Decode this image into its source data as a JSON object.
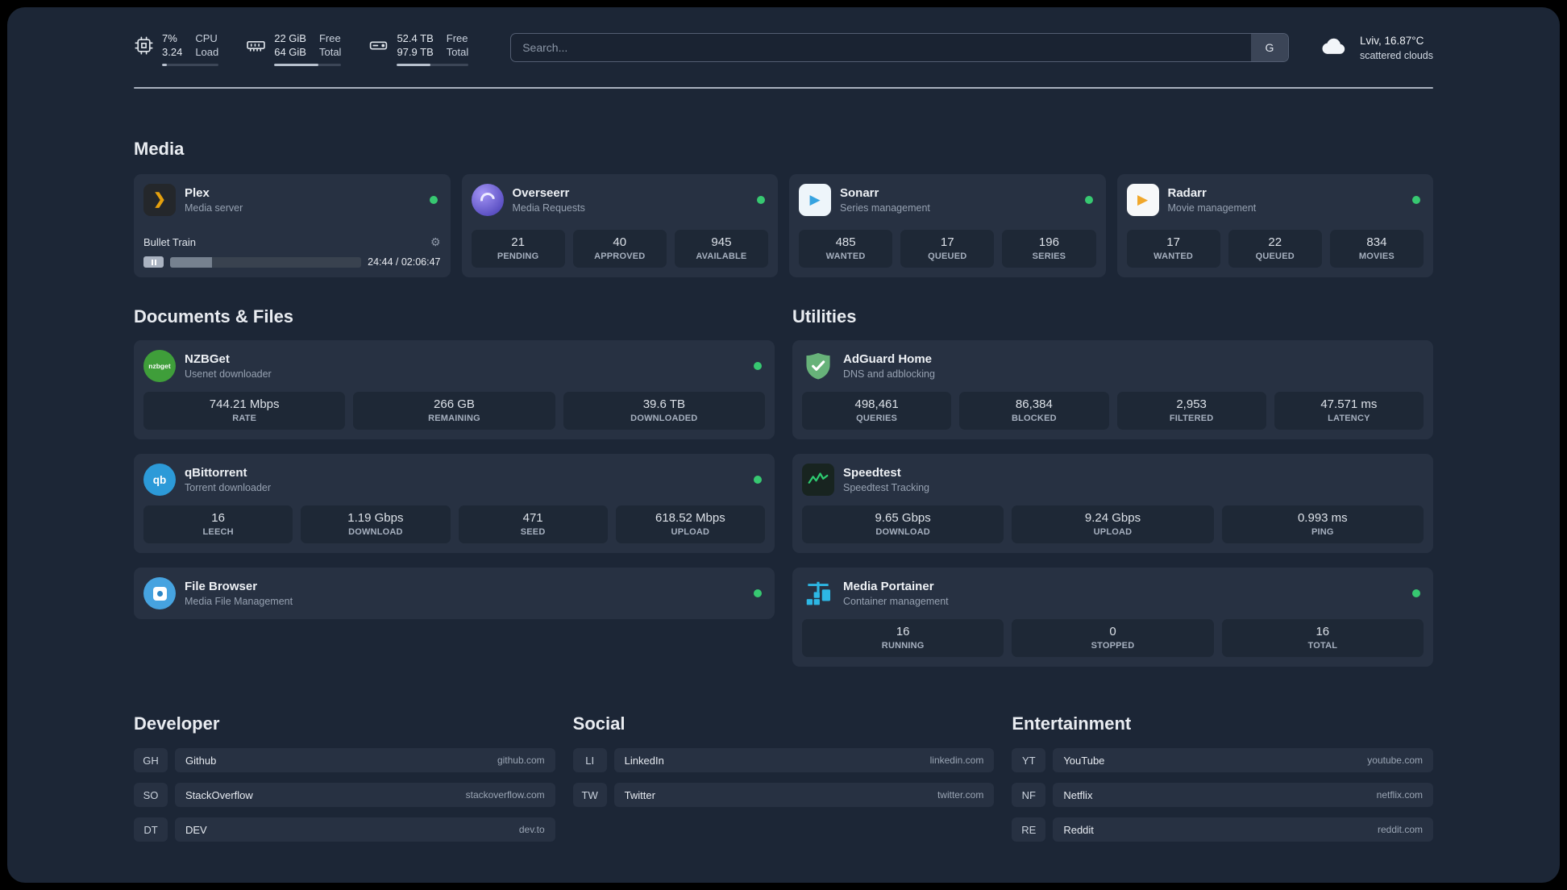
{
  "colors": {
    "status_online": "#37c871",
    "accent_plex": "#e5a00d",
    "accent_overseerr": "#7b6cf0",
    "accent_sonarr": "#36a3e0",
    "accent_radarr": "#f0a72b",
    "accent_nzbget": "#3f9e3a",
    "accent_qbittorrent": "#2c9ad8",
    "accent_adguard": "#67b279",
    "accent_speedtest": "#2ecc71",
    "accent_filebrowser": "#46a3e0",
    "accent_portainer": "#2db7e4"
  },
  "topbar": {
    "cpu": {
      "icon": "cpu-chip-icon",
      "percent": "7%",
      "load": "3.24",
      "label_top": "CPU",
      "label_bottom": "Load",
      "bar_percent": 8
    },
    "memory": {
      "icon": "ram-icon",
      "free": "22 GiB",
      "total": "64 GiB",
      "label_top": "Free",
      "label_bottom": "Total",
      "bar_percent": 66
    },
    "disk": {
      "icon": "hard-drive-icon",
      "free": "52.4 TB",
      "total": "97.9 TB",
      "label_top": "Free",
      "label_bottom": "Total",
      "bar_percent": 47
    },
    "search": {
      "placeholder": "Search...",
      "button": "G"
    },
    "weather": {
      "icon": "cloud-icon",
      "location": "Lviv, 16.87°C",
      "condition": "scattered clouds"
    }
  },
  "sections": {
    "media": {
      "title": "Media",
      "plex": {
        "name": "Plex",
        "subtitle": "Media server",
        "icon": "plex-icon",
        "online": true,
        "now_playing": {
          "title": "Bullet Train",
          "time": "24:44 / 02:06:47",
          "progress_percent": 22
        }
      },
      "overseerr": {
        "name": "Overseerr",
        "subtitle": "Media Requests",
        "icon": "overseerr-icon",
        "online": true,
        "stats": [
          {
            "value": "21",
            "label": "PENDING"
          },
          {
            "value": "40",
            "label": "APPROVED"
          },
          {
            "value": "945",
            "label": "AVAILABLE"
          }
        ]
      },
      "sonarr": {
        "name": "Sonarr",
        "subtitle": "Series management",
        "icon": "sonarr-icon",
        "online": true,
        "stats": [
          {
            "value": "485",
            "label": "WANTED"
          },
          {
            "value": "17",
            "label": "QUEUED"
          },
          {
            "value": "196",
            "label": "SERIES"
          }
        ]
      },
      "radarr": {
        "name": "Radarr",
        "subtitle": "Movie management",
        "icon": "radarr-icon",
        "online": true,
        "stats": [
          {
            "value": "17",
            "label": "WANTED"
          },
          {
            "value": "22",
            "label": "QUEUED"
          },
          {
            "value": "834",
            "label": "MOVIES"
          }
        ]
      }
    },
    "documents": {
      "title": "Documents & Files",
      "nzbget": {
        "name": "NZBGet",
        "subtitle": "Usenet downloader",
        "icon": "nzbget-icon",
        "icon_word": "nzbget",
        "online": true,
        "stats": [
          {
            "value": "744.21 Mbps",
            "label": "RATE"
          },
          {
            "value": "266 GB",
            "label": "REMAINING"
          },
          {
            "value": "39.6 TB",
            "label": "DOWNLOADED"
          }
        ]
      },
      "qbittorrent": {
        "name": "qBittorrent",
        "subtitle": "Torrent downloader",
        "icon": "qbittorrent-icon",
        "icon_word": "qb",
        "online": true,
        "stats": [
          {
            "value": "16",
            "label": "LEECH"
          },
          {
            "value": "1.19 Gbps",
            "label": "DOWNLOAD"
          },
          {
            "value": "471",
            "label": "SEED"
          },
          {
            "value": "618.52 Mbps",
            "label": "UPLOAD"
          }
        ]
      },
      "filebrowser": {
        "name": "File Browser",
        "subtitle": "Media File Management",
        "icon": "filebrowser-icon",
        "online": true
      }
    },
    "utilities": {
      "title": "Utilities",
      "adguard": {
        "name": "AdGuard Home",
        "subtitle": "DNS and adblocking",
        "icon": "adguard-shield-icon",
        "stats": [
          {
            "value": "498,461",
            "label": "QUERIES"
          },
          {
            "value": "86,384",
            "label": "BLOCKED"
          },
          {
            "value": "2,953",
            "label": "FILTERED"
          },
          {
            "value": "47.571 ms",
            "label": "LATENCY"
          }
        ]
      },
      "speedtest": {
        "name": "Speedtest",
        "subtitle": "Speedtest Tracking",
        "icon": "speedtest-graph-icon",
        "stats": [
          {
            "value": "9.65 Gbps",
            "label": "DOWNLOAD"
          },
          {
            "value": "9.24 Gbps",
            "label": "UPLOAD"
          },
          {
            "value": "0.993 ms",
            "label": "PING"
          }
        ]
      },
      "portainer": {
        "name": "Media Portainer",
        "subtitle": "Container management",
        "icon": "portainer-crane-icon",
        "online": true,
        "stats": [
          {
            "value": "16",
            "label": "RUNNING"
          },
          {
            "value": "0",
            "label": "STOPPED"
          },
          {
            "value": "16",
            "label": "TOTAL"
          }
        ]
      }
    },
    "developer": {
      "title": "Developer",
      "links": [
        {
          "abbr": "GH",
          "name": "Github",
          "domain": "github.com"
        },
        {
          "abbr": "SO",
          "name": "StackOverflow",
          "domain": "stackoverflow.com"
        },
        {
          "abbr": "DT",
          "name": "DEV",
          "domain": "dev.to"
        }
      ]
    },
    "social": {
      "title": "Social",
      "links": [
        {
          "abbr": "LI",
          "name": "LinkedIn",
          "domain": "linkedin.com"
        },
        {
          "abbr": "TW",
          "name": "Twitter",
          "domain": "twitter.com"
        }
      ]
    },
    "entertainment": {
      "title": "Entertainment",
      "links": [
        {
          "abbr": "YT",
          "name": "YouTube",
          "domain": "youtube.com"
        },
        {
          "abbr": "NF",
          "name": "Netflix",
          "domain": "netflix.com"
        },
        {
          "abbr": "RE",
          "name": "Reddit",
          "domain": "reddit.com"
        }
      ]
    }
  }
}
